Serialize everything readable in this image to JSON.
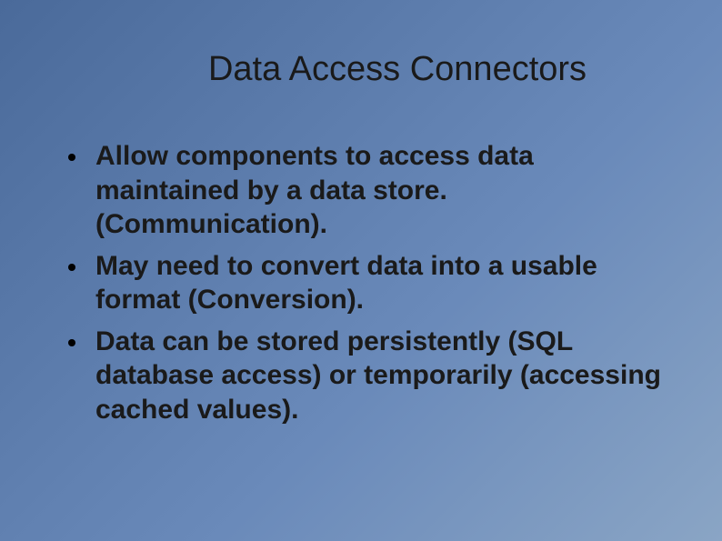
{
  "slide": {
    "title": "Data Access Connectors",
    "bullets": [
      "Allow components to access data maintained by a data store. (Communication).",
      "May need to convert data into a usable format (Conversion).",
      "Data can be stored persistently (SQL database access) or temporarily (accessing cached values)."
    ]
  }
}
